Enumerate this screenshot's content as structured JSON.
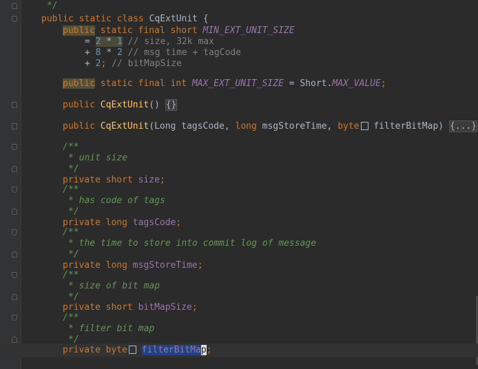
{
  "code": {
    "c_end": "*/",
    "class_decl": {
      "kw_public": "public",
      "kw_static": "static",
      "kw_class": "class",
      "class_name": "CqExtUnit",
      "brace": "{"
    },
    "min_size": {
      "kw_public": "public",
      "kw_static_final": "static final",
      "kw_type": "short",
      "const_name": "MIN_EXT_UNIT_SIZE",
      "eq": "=",
      "num_2": "2",
      "op_mul": "*",
      "num_1": "1",
      "comment_1": "// size, 32k max",
      "plus": "+",
      "num_8": "8",
      "num_2b": "2",
      "comment_2": "// msg time + tagCode",
      "num_2c": "2",
      "semi": ";",
      "comment_3": "// bitMapSize"
    },
    "max_size": {
      "kw_public": "public",
      "kw_static_final": "static final",
      "kw_type": "int",
      "const_name": "MAX_EXT_UNIT_SIZE",
      "eq": "=",
      "ref_class": "Short.",
      "ref_const": "MAX_VALUE",
      "semi": ";"
    },
    "ctor1": {
      "kw_public": "public",
      "name": "CqExtUnit",
      "parens": "()",
      "body": "{}"
    },
    "ctor2": {
      "kw_public": "public",
      "name": "CqExtUnit",
      "open": "(",
      "p1_type": "Long",
      "p1_name": "tagsCode,",
      "p2_type": "long",
      "p2_name": "msgStoreTime,",
      "p3_type": "byte",
      "p3_name": "filterBitMap)",
      "folded": "{...}"
    },
    "doc_open": "/**",
    "doc_close": "*/",
    "f_size": {
      "doc": "* unit size",
      "kw_private": "private",
      "kw_type": "short",
      "name": "size",
      "semi": ";"
    },
    "f_tags": {
      "doc": "* has code of tags",
      "kw_private": "private",
      "kw_type": "long",
      "name": "tagsCode",
      "semi": ";"
    },
    "f_time": {
      "doc": "* the time to store into commit log of message",
      "kw_private": "private",
      "kw_type": "long",
      "name": "msgStoreTime",
      "semi": ";"
    },
    "f_bitmapsize": {
      "doc": "* size of bit map",
      "kw_private": "private",
      "kw_type": "short",
      "name": "bitMapSize",
      "semi": ";"
    },
    "f_filter": {
      "doc": "* filter bit map",
      "kw_private": "private",
      "kw_type": "byte",
      "name_a": "filterBitMa",
      "name_caret": "p",
      "semi": ";"
    }
  }
}
